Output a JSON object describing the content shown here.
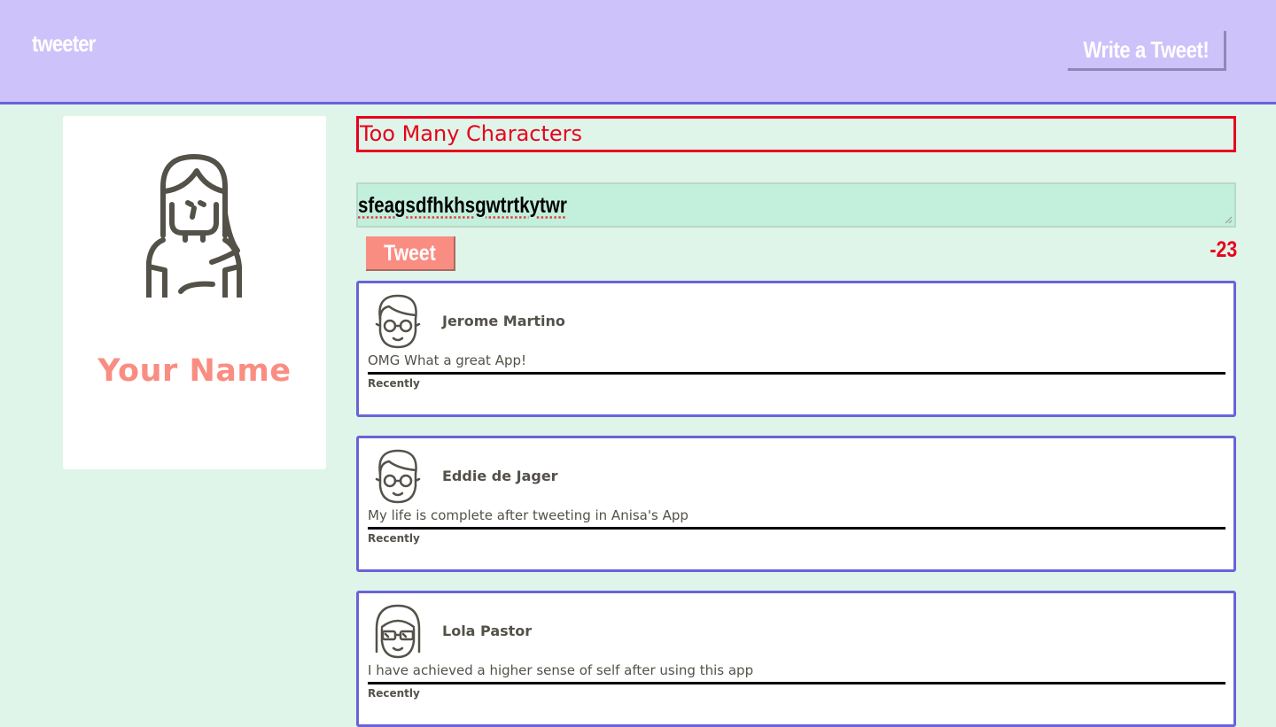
{
  "nav": {
    "brand": "tweeter",
    "write_button": "Write a Tweet!"
  },
  "profile": {
    "avatar_icon": "female-user-icon",
    "name": "Your Name"
  },
  "compose": {
    "error": "Too Many Characters",
    "text": "sfeagsdfhkhsgwtrtkytwr",
    "tweet_button": "Tweet",
    "counter": "-23"
  },
  "tweets": [
    {
      "avatar_icon": "male-glasses-avatar-icon",
      "name": "Jerome Martino",
      "text": "OMG What a great App!",
      "time": "Recently"
    },
    {
      "avatar_icon": "male-glasses-avatar-icon",
      "name": "Eddie de Jager",
      "text": "My life is complete after tweeting in Anisa's App",
      "time": "Recently"
    },
    {
      "avatar_icon": "female-sunglasses-avatar-icon",
      "name": "Lola Pastor",
      "text": "I have achieved a higher sense of self after using this app",
      "time": "Recently"
    }
  ],
  "colors": {
    "nav_bg": "#cdc2f9",
    "page_bg": "#dff5ea",
    "accent": "#6a63d8",
    "pink": "#fa8d82",
    "error": "#e8001c"
  }
}
